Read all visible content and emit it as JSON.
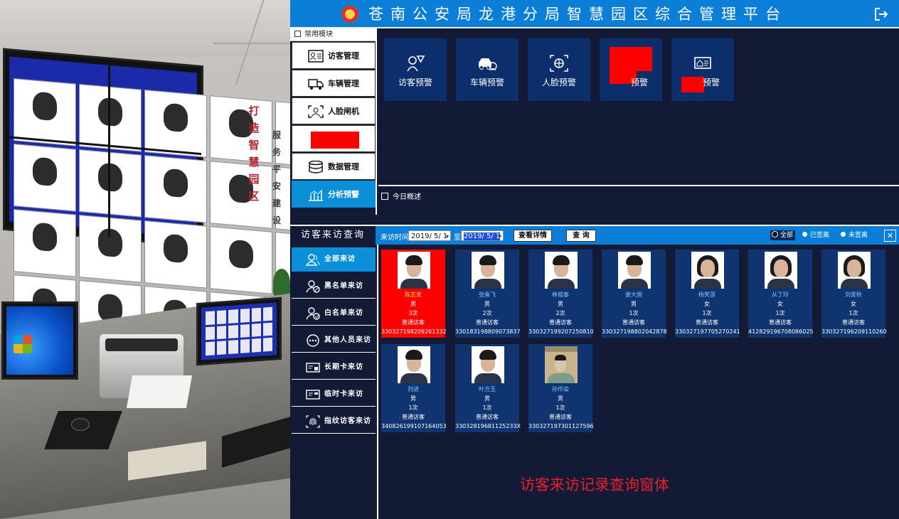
{
  "header": {
    "title": "苍南公安局龙港分局智慧园区综合管理平台"
  },
  "left_menu": {
    "caption": "常用模块",
    "items": [
      {
        "label": "访客管理",
        "icon": "visitor-card-icon"
      },
      {
        "label": "车辆管理",
        "icon": "truck-icon"
      },
      {
        "label": "人脸闸机",
        "icon": "face-scan-icon"
      },
      {
        "label": "",
        "icon": "redacted"
      },
      {
        "label": "数据管理",
        "icon": "database-icon"
      },
      {
        "label": "分析预警",
        "icon": "chart-icon"
      }
    ]
  },
  "modules": {
    "tiles": [
      {
        "label": "访客预警",
        "icon": "visitor-alert-icon"
      },
      {
        "label": "车辆预警",
        "icon": "car-alert-icon"
      },
      {
        "label": "人脸预警",
        "icon": "face-alert-icon"
      },
      {
        "label": "预警",
        "icon": "redacted"
      },
      {
        "label": "预警",
        "icon": "house-card-icon"
      }
    ]
  },
  "overview": {
    "label": "今日概述"
  },
  "query": {
    "title": "访客来访查询",
    "time_label": "来访时间",
    "date_from": "2019/ 5/ 1",
    "to_label": "至",
    "date_to": "2019/ 5/ 1",
    "detail_button": "查看详情",
    "search_button": "查 询",
    "radio_options": [
      "全部",
      "已签离",
      "未签离"
    ],
    "close": "✕"
  },
  "categories": [
    {
      "label": "全部来访",
      "icon": "people-icon"
    },
    {
      "label": "黑名单来访",
      "icon": "user-block-icon"
    },
    {
      "label": "白名单来访",
      "icon": "user-check-icon"
    },
    {
      "label": "其他人员来访",
      "icon": "more-dots-icon"
    },
    {
      "label": "长期卡来访",
      "icon": "card-icon"
    },
    {
      "label": "临时卡来访",
      "icon": "temp-card-icon"
    },
    {
      "label": "指纹访客来访",
      "icon": "fingerprint-icon"
    }
  ],
  "visitors": [
    {
      "name": "陈志发",
      "gender": "男",
      "count": "3次",
      "type": "普通访客",
      "id": "330327198209261332",
      "highlight": true
    },
    {
      "name": "张乘飞",
      "gender": "男",
      "count": "2次",
      "type": "普通访客",
      "id": "330183198809073837"
    },
    {
      "name": "林祖泰",
      "gender": "男",
      "count": "2次",
      "type": "普通访客",
      "id": "330327199207250810"
    },
    {
      "name": "谢大国",
      "gender": "男",
      "count": "1次",
      "type": "普通访客",
      "id": "330327198802042878"
    },
    {
      "name": "杨笑莲",
      "gender": "女",
      "count": "1次",
      "type": "普通访客",
      "id": "330327197705270241"
    },
    {
      "name": "从丁玲",
      "gender": "女",
      "count": "1次",
      "type": "普通访客",
      "id": "412829196708086025"
    },
    {
      "name": "刘爱秋",
      "gender": "女",
      "count": "1次",
      "type": "普通访客",
      "id": "330327196209110260"
    },
    {
      "name": "刘进",
      "gender": "男",
      "count": "1次",
      "type": "普通访客",
      "id": "340826199107164053"
    },
    {
      "name": "叶方玉",
      "gender": "男",
      "count": "1次",
      "type": "普通访客",
      "id": "33032819681125233X"
    },
    {
      "name": "孙作染",
      "gender": "男",
      "count": "1次",
      "type": "普通访客",
      "id": "330327197301127596"
    }
  ],
  "caption": "访客来访记录查询窗体",
  "photo": {
    "slogan_left": "打造智慧园区",
    "slogan_right": "服务平安建设"
  },
  "colors": {
    "header_blue": "#0b7fd8",
    "panel_navy": "#131a36",
    "tile_blue": "#0c2f6b",
    "highlight_red": "#ff0000",
    "caption_red": "#e8202a"
  }
}
